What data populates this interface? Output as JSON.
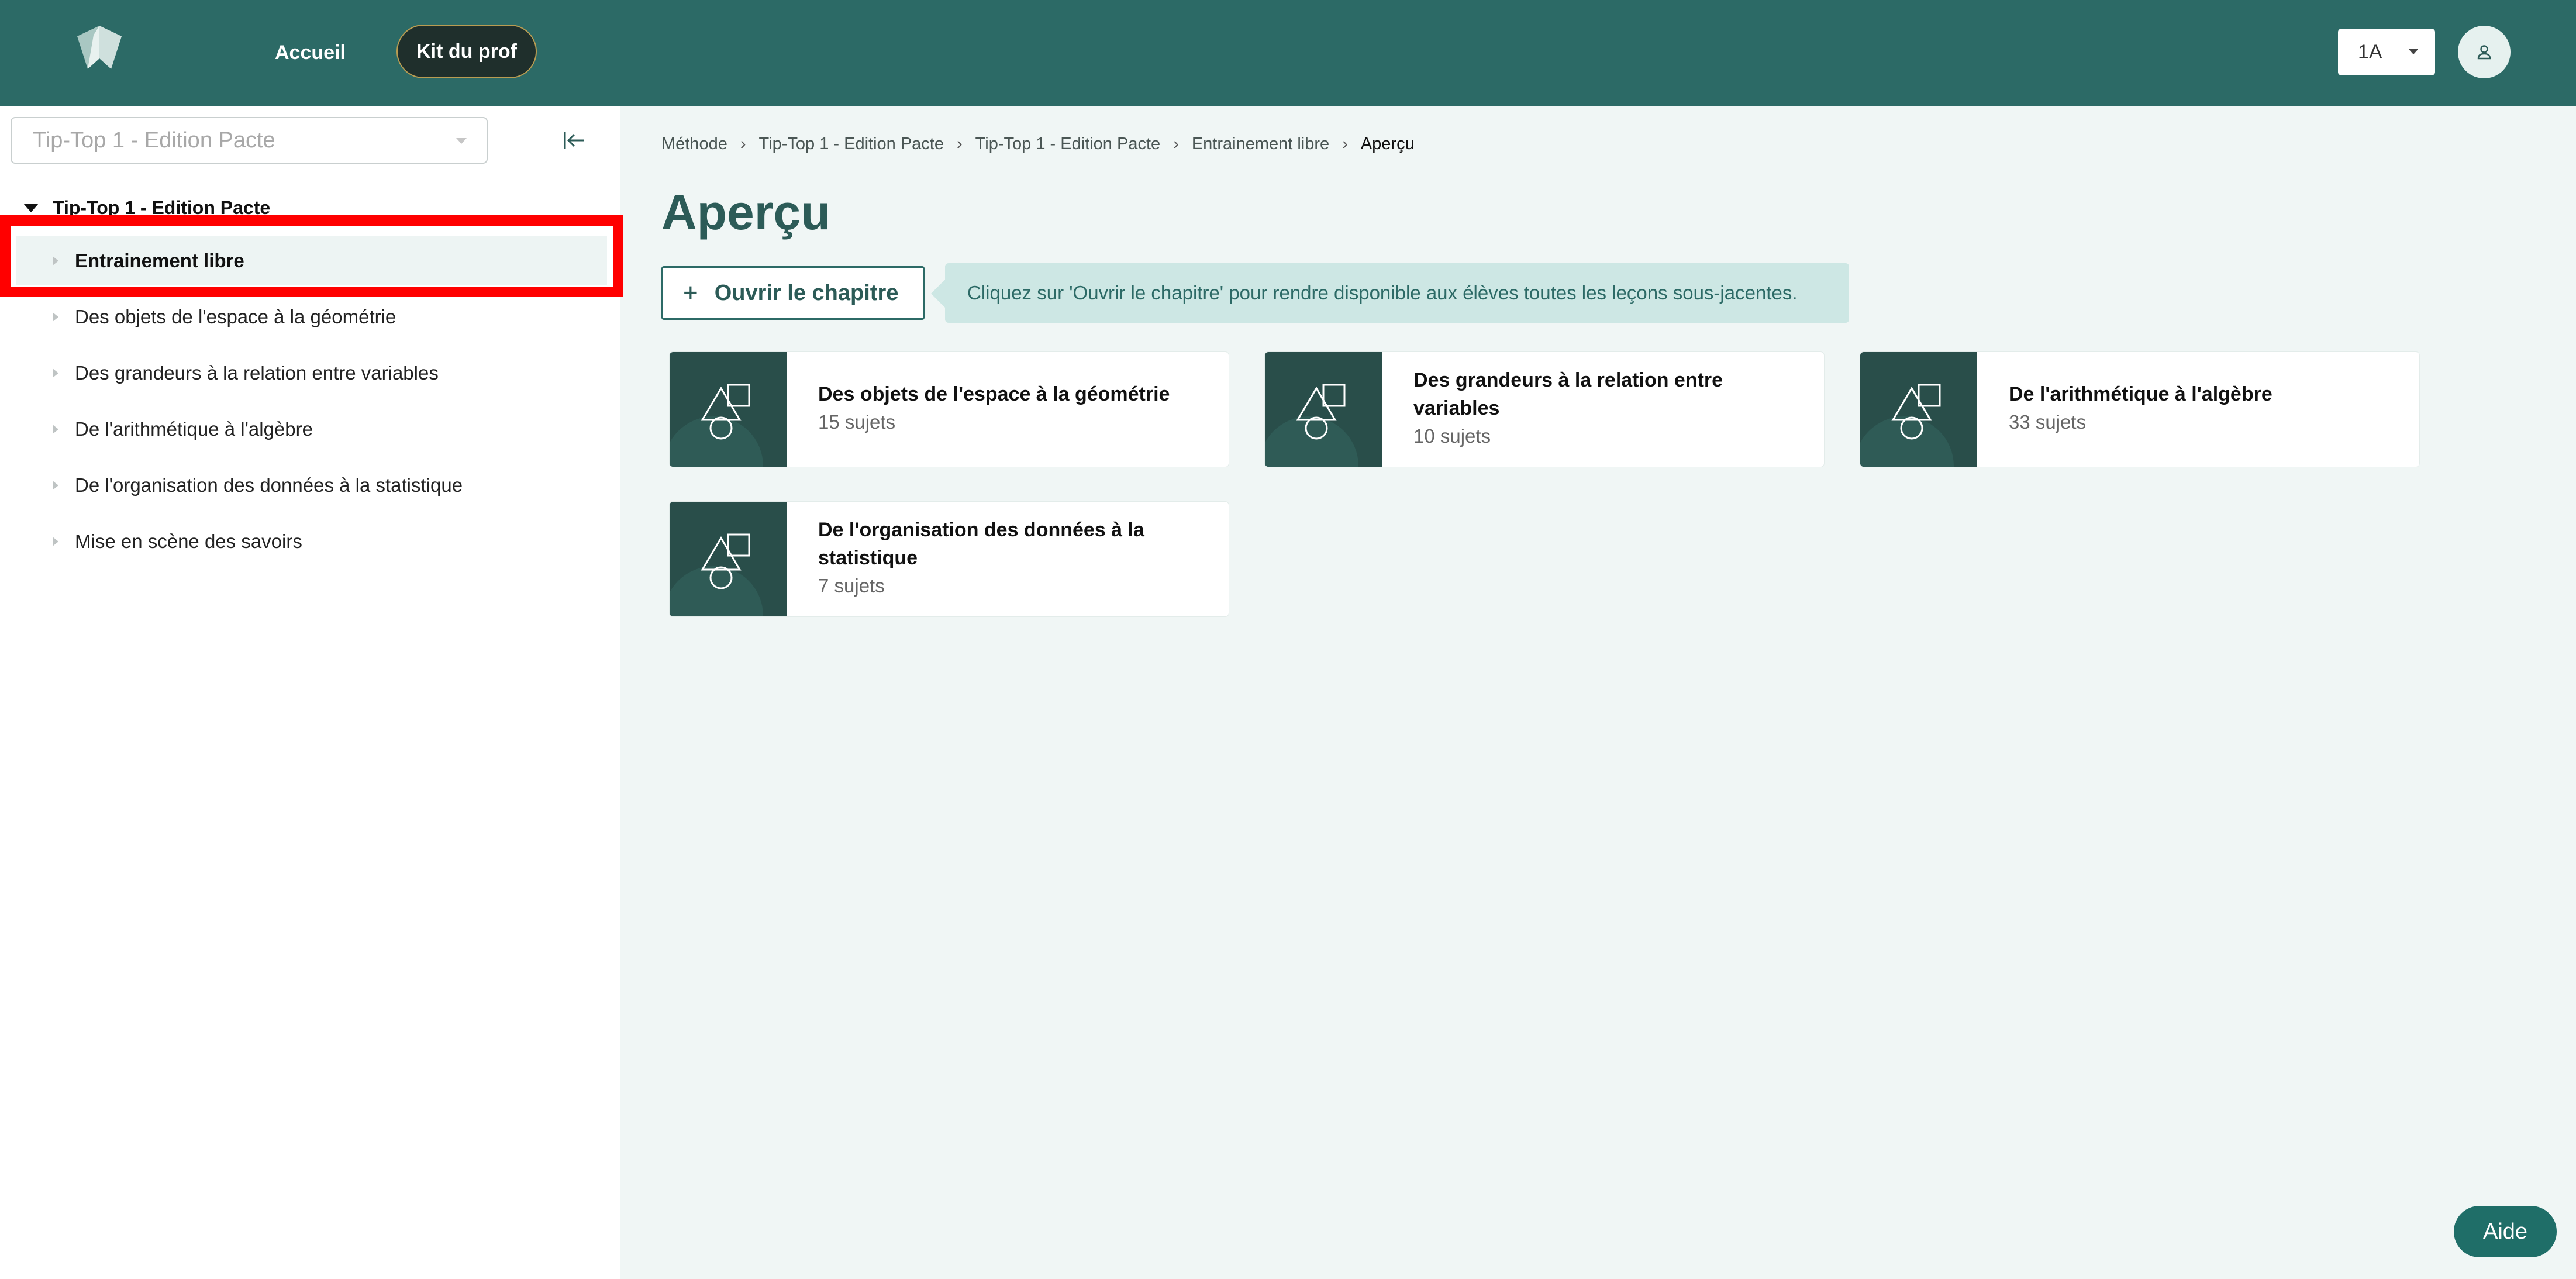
{
  "header": {
    "nav": {
      "home_label": "Accueil",
      "kit_label": "Kit du prof"
    },
    "class_select": {
      "value": "1A"
    }
  },
  "sidebar": {
    "book_select": {
      "value": "Tip-Top 1 - Edition Pacte"
    },
    "tree": {
      "root_label": "Tip-Top 1 - Edition Pacte",
      "items": [
        {
          "label": "Entrainement libre",
          "selected": true
        },
        {
          "label": "Des objets de l'espace à la géométrie"
        },
        {
          "label": "Des grandeurs à la relation entre variables"
        },
        {
          "label": "De l'arithmétique à l'algèbre"
        },
        {
          "label": "De l'organisation des données à la statistique"
        },
        {
          "label": "Mise en scène des savoirs"
        }
      ]
    }
  },
  "main": {
    "breadcrumb": [
      "Méthode",
      "Tip-Top 1 - Edition Pacte",
      "Tip-Top 1 - Edition Pacte",
      "Entrainement libre",
      "Aperçu"
    ],
    "breadcrumb_separator": "›",
    "title": "Aperçu",
    "open_button_icon": "+",
    "open_button_label": "Ouvrir le chapitre",
    "hint_text": "Cliquez sur 'Ouvrir le chapitre' pour rendre disponible aux élèves toutes les leçons sous-jacentes.",
    "cards": [
      {
        "title": "Des objets de l'espace à la géométrie",
        "subtitle": "15 sujets"
      },
      {
        "title": "Des grandeurs à la relation entre variables",
        "subtitle": "10 sujets"
      },
      {
        "title": "De l'arithmétique à l'algèbre",
        "subtitle": "33 sujets"
      },
      {
        "title": "De l'organisation des données à la statistique",
        "subtitle": "7 sujets"
      }
    ]
  },
  "help_button_label": "Aide",
  "colors": {
    "header": "#2c6a66",
    "accent": "#2c5b57",
    "highlight": "#ff0000",
    "hint_bg": "#cde7e4"
  }
}
